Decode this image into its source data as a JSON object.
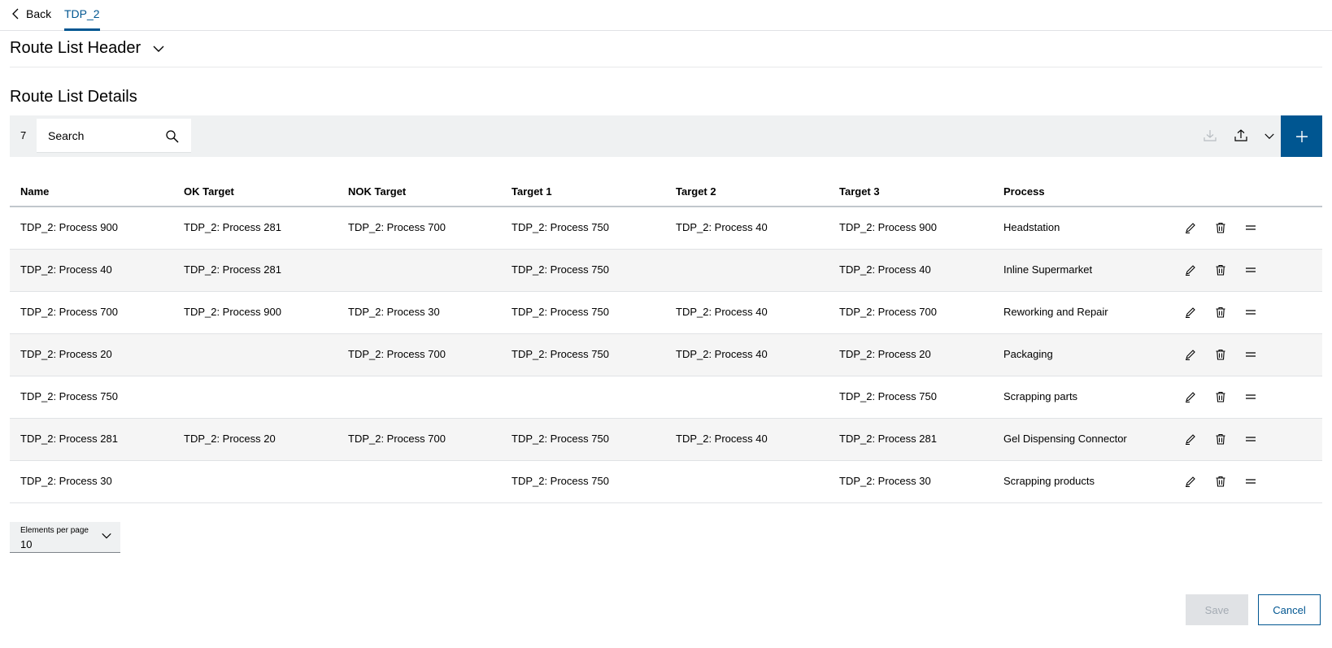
{
  "nav": {
    "back_label": "Back",
    "active_tab": "TDP_2"
  },
  "header_section": {
    "title": "Route List Header"
  },
  "details_section": {
    "title": "Route List Details"
  },
  "toolbar": {
    "count": "7",
    "search_placeholder": "Search"
  },
  "colors": {
    "accent": "#005691",
    "toolbar_bg": "#eff1f2",
    "alt_row": "#f5f5f5",
    "disabled_bg": "#e0e2e5",
    "disabled_text": "#a4abb3"
  },
  "icons": [
    "chevron-left-icon",
    "chevron-down-icon",
    "search-icon",
    "download-icon",
    "upload-icon",
    "plus-icon",
    "pencil-icon",
    "trash-icon",
    "drag-handle-icon"
  ],
  "table": {
    "columns": [
      "Name",
      "OK Target",
      "NOK Target",
      "Target 1",
      "Target 2",
      "Target 3",
      "Process"
    ],
    "rows": [
      [
        "TDP_2: Process 900",
        "TDP_2: Process 281",
        "TDP_2: Process 700",
        "TDP_2: Process 750",
        "TDP_2: Process 40",
        "TDP_2: Process 900",
        "Headstation"
      ],
      [
        "TDP_2: Process 40",
        "TDP_2: Process 281",
        "",
        "TDP_2: Process 750",
        "",
        "TDP_2: Process 40",
        "Inline Supermarket"
      ],
      [
        "TDP_2: Process 700",
        "TDP_2: Process 900",
        "TDP_2: Process 30",
        "TDP_2: Process 750",
        "TDP_2: Process 40",
        "TDP_2: Process 700",
        "Reworking and Repair"
      ],
      [
        "TDP_2: Process 20",
        "",
        "TDP_2: Process 700",
        "TDP_2: Process 750",
        "TDP_2: Process 40",
        "TDP_2: Process 20",
        "Packaging"
      ],
      [
        "TDP_2: Process 750",
        "",
        "",
        "",
        "",
        "TDP_2: Process 750",
        "Scrapping parts"
      ],
      [
        "TDP_2: Process 281",
        "TDP_2: Process 20",
        "TDP_2: Process 700",
        "TDP_2: Process 750",
        "TDP_2: Process 40",
        "TDP_2: Process 281",
        "Gel Dispensing Connector"
      ],
      [
        "TDP_2: Process 30",
        "",
        "",
        "TDP_2: Process 750",
        "",
        "TDP_2: Process 30",
        "Scrapping products"
      ]
    ]
  },
  "pagination": {
    "label": "Elements per page",
    "value": "10"
  },
  "footer": {
    "save_label": "Save",
    "cancel_label": "Cancel"
  }
}
